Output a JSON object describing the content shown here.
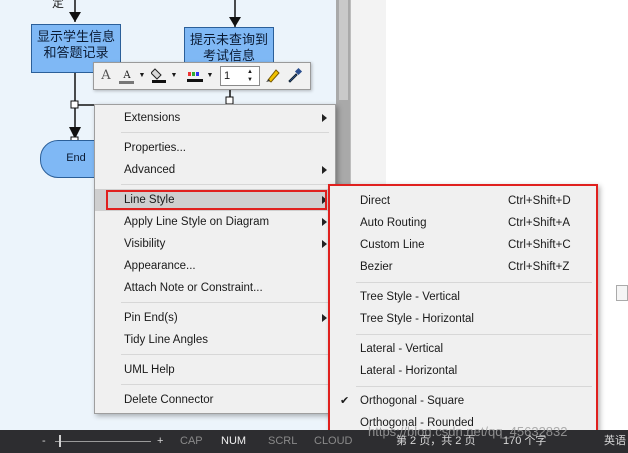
{
  "diagram": {
    "top_fragment": "定",
    "node1_lines": [
      "显示学生信息",
      "和答题记录"
    ],
    "node2_lines": [
      "提示未查询到",
      "考试信息"
    ],
    "end_label": "End"
  },
  "mini_toolbar": {
    "icons": [
      "font-icon",
      "font-color-icon",
      "fill-color-icon",
      "line-color-icon",
      "paint-brush-icon",
      "eyedropper-icon"
    ],
    "line_width_value": "1"
  },
  "context_menu": {
    "items": [
      {
        "label": "Extensions",
        "submenu": true
      },
      {
        "label": "Properties...",
        "submenu": false
      },
      {
        "label": "Advanced",
        "submenu": true
      },
      {
        "label": "Line Style",
        "submenu": true,
        "highlighted": true
      },
      {
        "label": "Apply Line Style on Diagram",
        "submenu": true
      },
      {
        "label": "Visibility",
        "submenu": true
      },
      {
        "label": "Appearance...",
        "submenu": false
      },
      {
        "label": "Attach Note or Constraint...",
        "submenu": false
      },
      {
        "label": "Pin End(s)",
        "submenu": true
      },
      {
        "label": "Tidy Line Angles",
        "submenu": false
      },
      {
        "label": "UML Help",
        "submenu": false
      },
      {
        "label": "Delete Connector",
        "submenu": false
      }
    ]
  },
  "line_style_submenu": {
    "items": [
      {
        "label": "Direct",
        "shortcut": "Ctrl+Shift+D",
        "checked": false
      },
      {
        "label": "Auto Routing",
        "shortcut": "Ctrl+Shift+A",
        "checked": false
      },
      {
        "label": "Custom Line",
        "shortcut": "Ctrl+Shift+C",
        "checked": false
      },
      {
        "label": "Bezier",
        "shortcut": "Ctrl+Shift+Z",
        "checked": false
      },
      {
        "label": "Tree Style - Vertical",
        "shortcut": "",
        "checked": false
      },
      {
        "label": "Tree Style - Horizontal",
        "shortcut": "",
        "checked": false
      },
      {
        "label": "Lateral - Vertical",
        "shortcut": "",
        "checked": false
      },
      {
        "label": "Lateral - Horizontal",
        "shortcut": "",
        "checked": false
      },
      {
        "label": "Orthogonal - Square",
        "shortcut": "",
        "checked": true
      },
      {
        "label": "Orthogonal - Rounded",
        "shortcut": "",
        "checked": false
      }
    ]
  },
  "status_bar": {
    "zoom_minus": "-",
    "zoom_plus": "+",
    "cap": "CAP",
    "num": "NUM",
    "scrl": "SCRL",
    "cloud": "CLOUD",
    "page_info": "第 2 页，共 2 页",
    "word_count": "170 个字",
    "lang": "英语"
  },
  "watermark": "https://blog.csdn.net/qq_45632832",
  "colors": {
    "highlight_border": "#e0201e",
    "node_fill": "#7fb8f5",
    "menu_bg": "#f0f0f0",
    "status_bg": "#2d2d30"
  }
}
